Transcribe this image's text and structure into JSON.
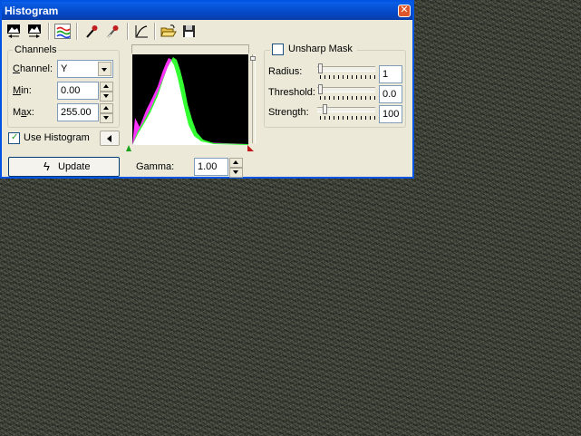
{
  "window": {
    "title": "Histogram"
  },
  "channels": {
    "group_title": "Channels",
    "channel_label": "Channel:",
    "channel_value": "Y",
    "min_label": "Min:",
    "min_value": "0.00",
    "max_label": "Max:",
    "max_value": "255.00",
    "use_histogram_label": "Use Histogram",
    "use_histogram_checked": true
  },
  "update_button": {
    "label": "Update"
  },
  "gamma": {
    "label": "Gamma:",
    "value": "1.00"
  },
  "unsharp": {
    "title": "Unsharp Mask",
    "checked": false,
    "radius_label": "Radius:",
    "radius_value": "1",
    "threshold_label": "Threshold:",
    "threshold_value": "0.0",
    "strength_label": "Strength:",
    "strength_value": "100"
  },
  "toolbar": {
    "icons": [
      "histogram-left-icon",
      "histogram-right-icon",
      "rgb-channels-icon",
      "black-eyedropper-icon",
      "white-eyedropper-icon",
      "curve-icon",
      "open-folder-icon",
      "save-disk-icon"
    ]
  },
  "colors": {
    "title_bar": "#0a5fe8",
    "window_bg": "#ece9d8",
    "histogram_bg": "#000000",
    "magenta": "#ff33ff",
    "green": "#33ff33"
  }
}
